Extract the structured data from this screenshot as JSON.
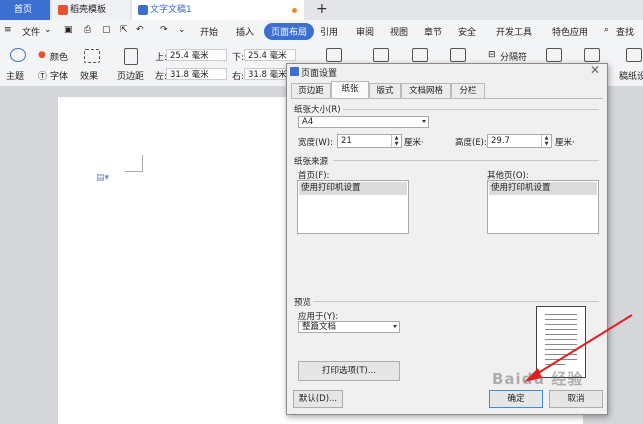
{
  "tabs": {
    "home": "首页",
    "template": "稻壳模板",
    "document": "文字文稿1",
    "new_tab": "+"
  },
  "menu": {
    "file": "文件",
    "items": [
      "开始",
      "插入",
      "页面布局",
      "引用",
      "审阅",
      "视图",
      "章节",
      "安全",
      "开发工具",
      "特色应用"
    ],
    "active": "页面布局",
    "search": "查找"
  },
  "ribbon": {
    "theme": "主题",
    "colors": "颜色",
    "fonts": "字体",
    "effects": "效果",
    "margins": "页边距",
    "top_label": "上:",
    "top_value": "25.4 毫米",
    "bottom_label": "下:",
    "bottom_value": "25.4 毫米",
    "left_label": "左:",
    "left_value": "31.8 毫米",
    "right_label": "右:",
    "right_value": "31.8 毫米",
    "columns_break": "分隔符",
    "stationery": "稿纸设"
  },
  "dialog": {
    "title": "页面设置",
    "tabs": [
      "页边距",
      "纸张",
      "版式",
      "文档网格",
      "分栏"
    ],
    "active_tab": "纸张",
    "paper_size_section": "纸张大小(R)",
    "paper_size_value": "A4",
    "width_label": "宽度(W):",
    "width_value": "21",
    "width_unit": "厘米·",
    "height_label": "高度(E):",
    "height_value": "29.7",
    "height_unit": "厘米·",
    "paper_source_section": "纸张来源",
    "first_page_label": "首页(F):",
    "first_page_value": "使用打印机设置",
    "other_pages_label": "其他页(O):",
    "other_pages_value": "使用打印机设置",
    "preview_section": "预览",
    "apply_to_label": "应用于(Y):",
    "apply_to_value": "整篇文档",
    "print_options_button": "打印选项(T)...",
    "default_button": "默认(D)...",
    "ok_button": "确定",
    "cancel_button": "取消"
  },
  "watermark": "Baidu 经验",
  "colors": {
    "accent": "#3d6fd0",
    "arrow": "#e02020"
  }
}
